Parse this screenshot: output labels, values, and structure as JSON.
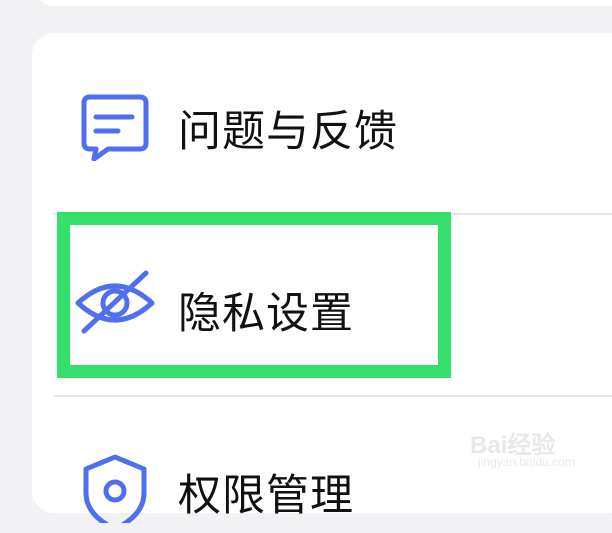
{
  "menu": {
    "items": [
      {
        "label": "问题与反馈",
        "icon": "feedback-message-icon"
      },
      {
        "label": "隐私设置",
        "icon": "eye-slash-icon"
      },
      {
        "label": "权限管理",
        "icon": "shield-user-icon"
      }
    ]
  },
  "annotation": {
    "highlight_color": "#35e06a",
    "target": "隐私设置"
  },
  "theme": {
    "icon_color": "#4f6ef0",
    "background": "#f2f2f4",
    "card": "#ffffff"
  },
  "watermark": {
    "brand": "Bai经验",
    "url": "jingyan.baidu.com"
  }
}
